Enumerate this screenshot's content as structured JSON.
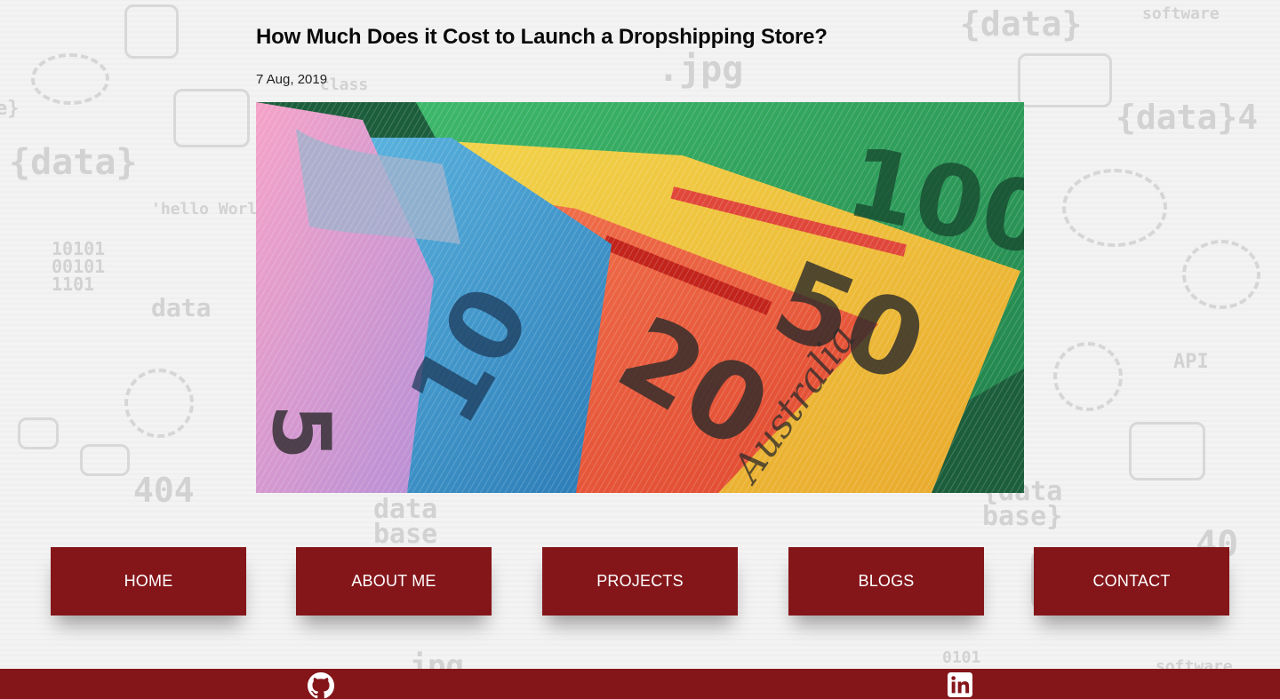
{
  "post": {
    "title": "How Much Does it Cost to Launch a Dropshipping Store?",
    "date": "7 Aug, 2019"
  },
  "hero_image": {
    "name": "australian-banknotes-image",
    "note_values": [
      "5",
      "10",
      "20",
      "50",
      "100"
    ]
  },
  "nav": {
    "items": [
      {
        "label": "HOME"
      },
      {
        "label": "ABOUT ME"
      },
      {
        "label": "PROJECTS"
      },
      {
        "label": "BLOGS"
      },
      {
        "label": "CONTACT"
      }
    ]
  },
  "footer": {
    "icons": [
      "github-icon",
      "linkedin-icon"
    ]
  },
  "colors": {
    "brand": "#84161a",
    "text": "#0a0a0a",
    "background": "#f3f3f3"
  }
}
